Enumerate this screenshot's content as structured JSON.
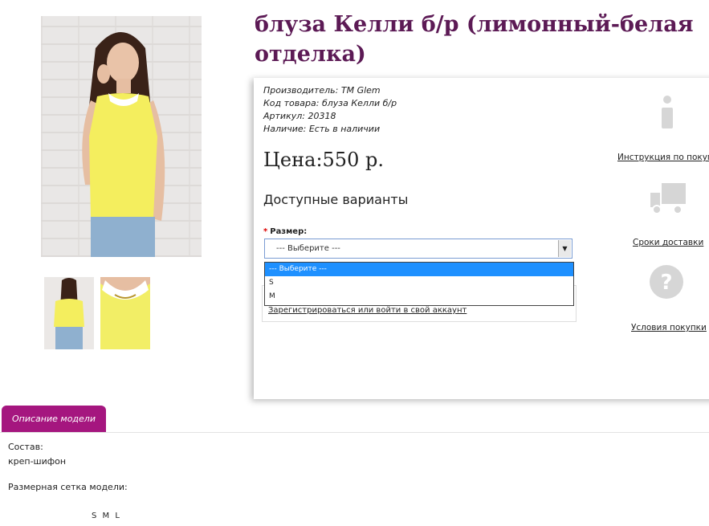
{
  "product": {
    "title": "блуза Келли б/р (лимонный-белая отделка)",
    "meta": [
      {
        "label": "Производитель:",
        "value": "TM Glem"
      },
      {
        "label": "Код товара:",
        "value": "блуза Келли б/р"
      },
      {
        "label": "Артикул:",
        "value": "20318"
      },
      {
        "label": "Наличие:",
        "value": "Есть в наличии"
      }
    ],
    "price": "Цена:550 р.",
    "variants_heading": "Доступные варианты",
    "size_required_mark": "*",
    "size_label": "Размер:",
    "size_select_value": "--- Выберите ---",
    "size_options": [
      "--- Выберите ---",
      "S",
      "M"
    ],
    "login_link": "Зарегистрироваться или войти в свой аккаунт"
  },
  "sidebar": {
    "links": [
      {
        "icon": "info-icon",
        "label": "Инструкция по покупке"
      },
      {
        "icon": "truck-icon",
        "label": "Сроки доставки"
      },
      {
        "icon": "question-icon",
        "label": "Условия покупки"
      }
    ]
  },
  "tabs": {
    "description_tab": "Описание модели"
  },
  "description": {
    "composition_label": "Состав:",
    "composition_value": "креп-шифон",
    "size_chart_label": "Размерная сетка модели:",
    "size_chart_values": "S M L"
  },
  "colors": {
    "title": "#5c1a55",
    "tab": "#a5167f",
    "dropdown_highlight": "#1e90ff",
    "blouse": "#f2ee66"
  }
}
